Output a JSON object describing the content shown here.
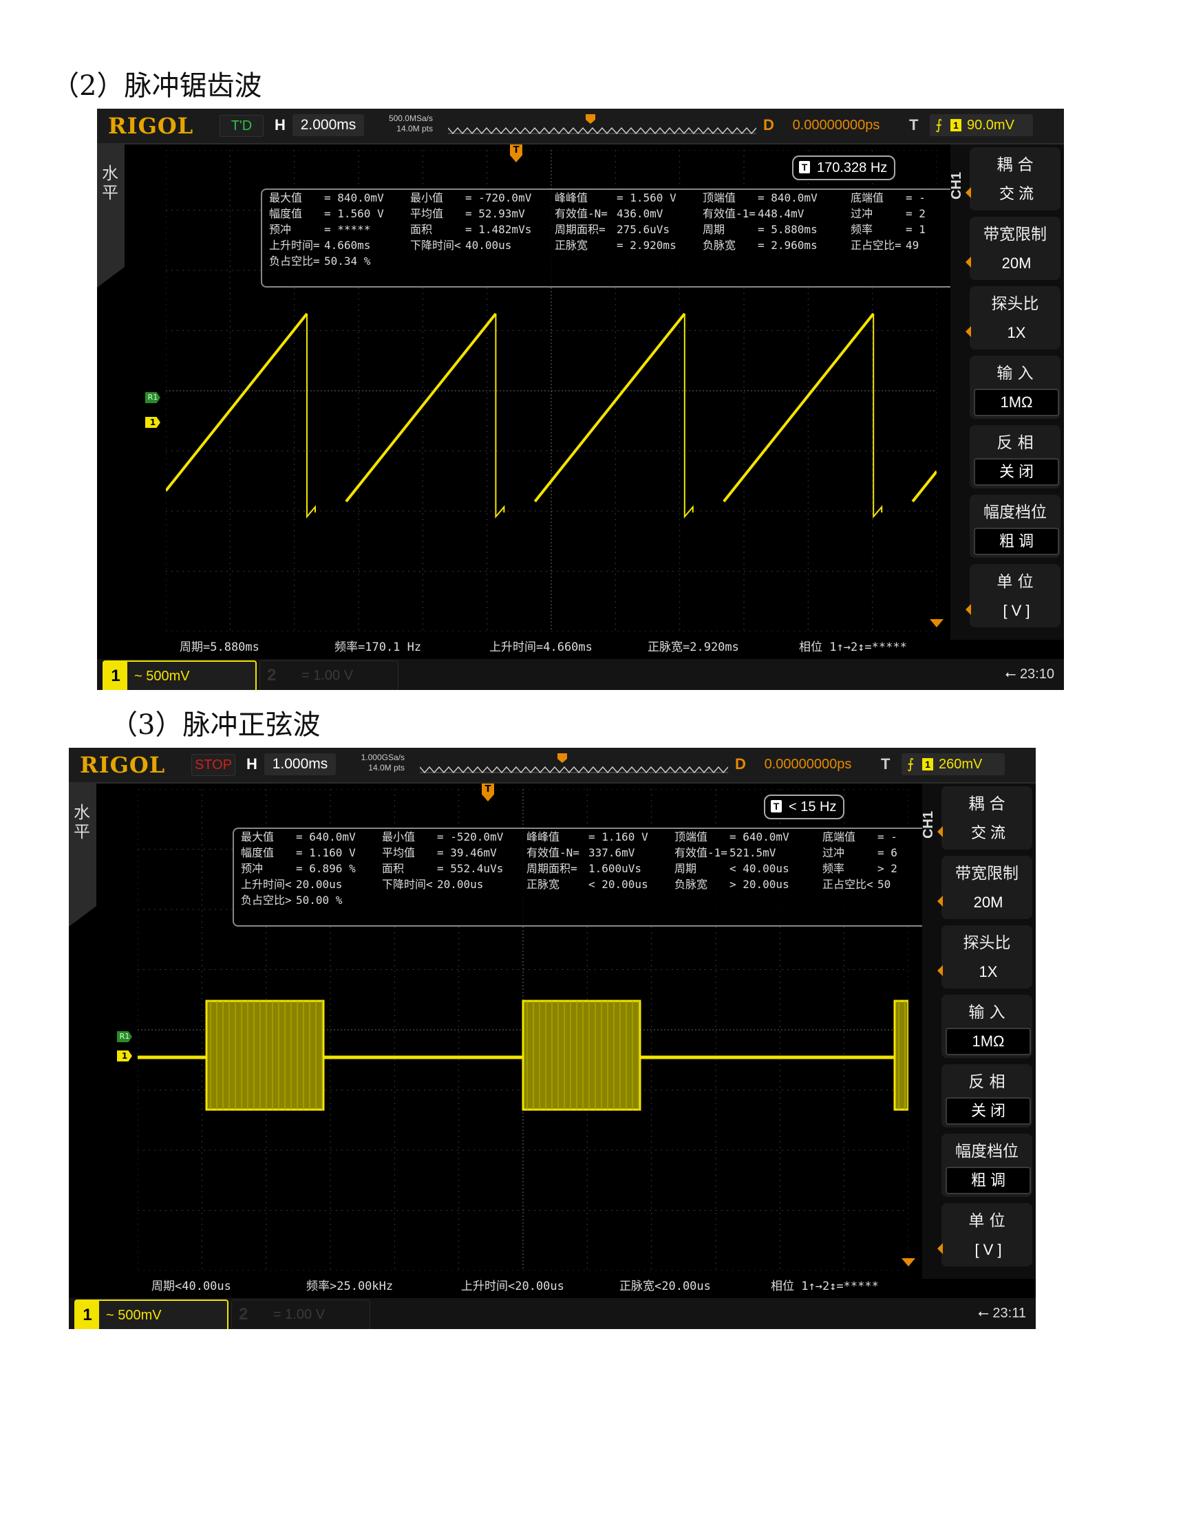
{
  "headings": {
    "h1": "（2）脉冲锯齿波",
    "h2": "（3）脉冲正弦波"
  },
  "scope1": {
    "logo": "RIGOL",
    "run_state": "T'D",
    "run_color": "#2fbf4a",
    "h_label": "H",
    "timebase": "2.000ms",
    "sample_rate": "500.0MSa/s",
    "mem_depth": "14.0M pts",
    "d_label": "D",
    "delay": "0.00000000ps",
    "t_label": "T",
    "trig_channel": "1",
    "trig_level": "90.0mV",
    "left_tab": "水平",
    "freq_counter_badge": "T",
    "freq_counter": "170.328 Hz",
    "trig_marker": "T",
    "r1_label": "R1",
    "ch1_label": "1",
    "measurements": [
      [
        "最大值",
        "= 840.0mV",
        "最小值",
        "= -720.0mV",
        "峰峰值",
        "= 1.560 V",
        "顶端值",
        "= 840.0mV",
        "底端值",
        "= -"
      ],
      [
        "幅度值",
        "= 1.560 V",
        "平均值",
        "= 52.93mV",
        "有效值-N=",
        "436.0mV",
        "有效值-1=",
        "448.4mV",
        "过冲",
        "= 2"
      ],
      [
        "预冲",
        "= *****",
        "面积",
        "= 1.482mVs",
        "周期面积=",
        "275.6uVs",
        "周期",
        "= 5.880ms",
        "频率",
        "= 1"
      ],
      [
        "上升时间=",
        "4.660ms",
        "下降时间<",
        "40.00us",
        "正脉宽",
        "= 2.920ms",
        "负脉宽",
        "= 2.960ms",
        "正占空比=",
        "49"
      ],
      [
        "负占空比=",
        "50.34 %",
        "",
        "",
        "",
        "",
        "",
        "",
        "",
        ""
      ]
    ],
    "bottom_meas": [
      "周期=5.880ms",
      "频率=170.1 Hz",
      "上升时间=4.660ms",
      "正脉宽=2.920ms",
      "相位 1↑→2↕=*****"
    ],
    "menu": {
      "channel": "CH1",
      "items": [
        {
          "title": "耦 合",
          "value": "交 流"
        },
        {
          "title": "带宽限制",
          "value": "20M"
        },
        {
          "title": "探头比",
          "value": "1X"
        },
        {
          "title": "输 入",
          "value": "1MΩ"
        },
        {
          "title": "反 相",
          "value": "关 闭"
        },
        {
          "title": "幅度档位",
          "value": "粗 调"
        },
        {
          "title": "单 位",
          "value": "[ V ]"
        }
      ]
    },
    "ch1_num": "1",
    "ch1_setting": "~ 500mV",
    "ch2_num": "2",
    "ch2_setting": "=  1.00 V",
    "usb_icon": "usb-icon",
    "clock": "23:10",
    "waveform": {
      "type": "sawtooth",
      "color": "#f3e400",
      "max_mV": 840.0,
      "min_mV": -720.0,
      "period_ms": 5.88,
      "rise_time_ms": 4.66,
      "timebase_ms_per_div": 2.0,
      "volts_per_div_mV": 500
    }
  },
  "scope2": {
    "logo": "RIGOL",
    "run_state": "STOP",
    "run_color": "#d02020",
    "h_label": "H",
    "timebase": "1.000ms",
    "sample_rate": "1.000GSa/s",
    "mem_depth": "14.0M pts",
    "d_label": "D",
    "delay": "0.00000000ps",
    "t_label": "T",
    "trig_channel": "1",
    "trig_level": "260mV",
    "left_tab": "水平",
    "freq_counter_badge": "T",
    "freq_counter": "< 15 Hz",
    "trig_marker": "T",
    "r1_label": "R1",
    "ch1_label": "1",
    "measurements": [
      [
        "最大值",
        "= 640.0mV",
        "最小值",
        "= -520.0mV",
        "峰峰值",
        "= 1.160 V",
        "顶端值",
        "= 640.0mV",
        "底端值",
        "= -"
      ],
      [
        "幅度值",
        "= 1.160 V",
        "平均值",
        "= 39.46mV",
        "有效值-N=",
        "337.6mV",
        "有效值-1=",
        "521.5mV",
        "过冲",
        "= 6"
      ],
      [
        "预冲",
        "= 6.896 %",
        "面积",
        "= 552.4uVs",
        "周期面积=",
        "1.600uVs",
        "周期",
        "< 40.00us",
        "频率",
        "> 2"
      ],
      [
        "上升时间<",
        "20.00us",
        "下降时间<",
        "20.00us",
        "正脉宽",
        "< 20.00us",
        "负脉宽",
        "> 20.00us",
        "正占空比<",
        "50"
      ],
      [
        "负占空比>",
        "50.00 %",
        "",
        "",
        "",
        "",
        "",
        "",
        "",
        ""
      ]
    ],
    "bottom_meas": [
      "周期<40.00us",
      "频率>25.00kHz",
      "上升时间<20.00us",
      "正脉宽<20.00us",
      "相位 1↑→2↕=*****"
    ],
    "menu": {
      "channel": "CH1",
      "items": [
        {
          "title": "耦 合",
          "value": "交 流"
        },
        {
          "title": "带宽限制",
          "value": "20M"
        },
        {
          "title": "探头比",
          "value": "1X"
        },
        {
          "title": "输 入",
          "value": "1MΩ"
        },
        {
          "title": "反 相",
          "value": "关 闭"
        },
        {
          "title": "幅度档位",
          "value": "粗 调"
        },
        {
          "title": "单 位",
          "value": "[ V ]"
        }
      ]
    },
    "ch1_num": "1",
    "ch1_setting": "~ 500mV",
    "ch2_num": "2",
    "ch2_setting": "=  1.00 V",
    "usb_icon": "usb-icon",
    "clock": "23:11",
    "waveform": {
      "type": "burst",
      "color": "#f3e400",
      "burst_high_mV": 640.0,
      "burst_low_mV": -520.0,
      "timebase_ms_per_div": 1.0,
      "volts_per_div_mV": 500
    }
  }
}
